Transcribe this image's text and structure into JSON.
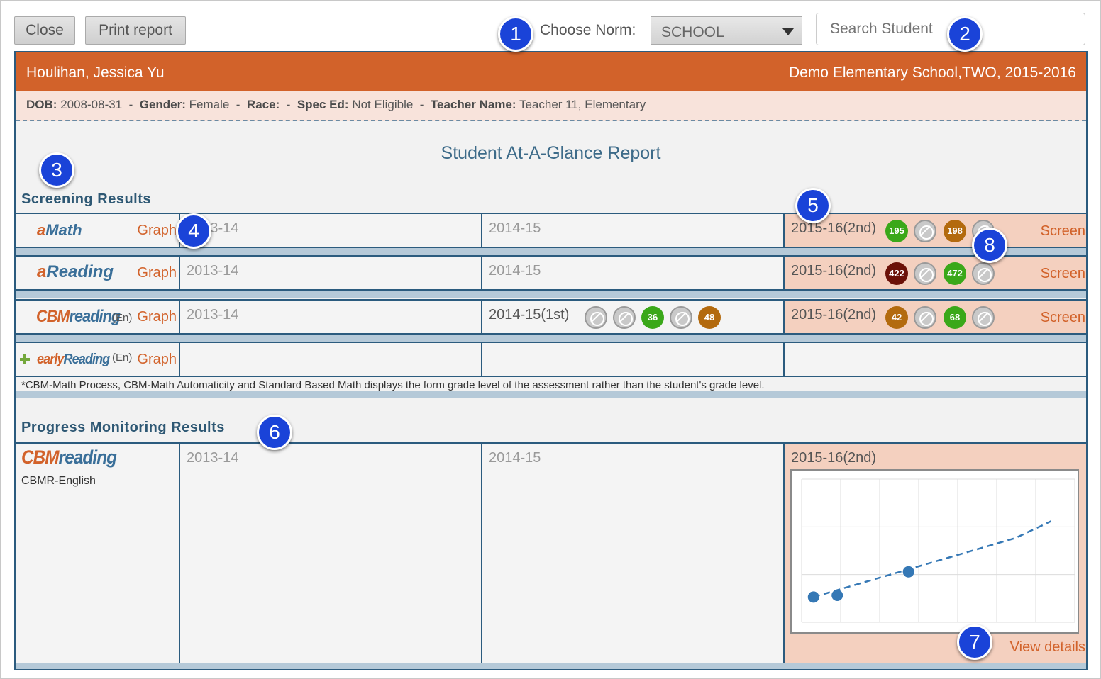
{
  "toolbar": {
    "close_label": "Close",
    "print_label": "Print report",
    "norm_label": "Choose Norm:",
    "norm_value": "SCHOOL",
    "search_placeholder": "Search Student"
  },
  "student": {
    "name": "Houlihan, Jessica Yu",
    "school": "Demo Elementary School,TWO, 2015-2016",
    "dob_label": "DOB:",
    "dob": "2008-08-31",
    "gender_label": "Gender:",
    "gender": "Female",
    "race_label": "Race:",
    "race": "",
    "spec_ed_label": "Spec Ed:",
    "spec_ed": "Not Eligible",
    "teacher_label": "Teacher Name:",
    "teacher": "Teacher 11, Elementary",
    "separator": "-"
  },
  "report_title": "Student At-A-Glance Report",
  "screening": {
    "title": "Screening Results",
    "graph_label": "Graph",
    "screen_label": "Screen",
    "rows": [
      {
        "logo_a": "a",
        "logo_rest": "Math",
        "lang": "",
        "y1": "2013-14",
        "y2": "2014-15",
        "y3": "2015-16(2nd)",
        "y2_badges": [],
        "y3_badges": [
          {
            "type": "green",
            "value": "195"
          },
          {
            "type": "na",
            "value": ""
          },
          {
            "type": "brown",
            "value": "198"
          },
          {
            "type": "na",
            "value": ""
          }
        ]
      },
      {
        "logo_a": "a",
        "logo_rest": "Reading",
        "lang": "",
        "y1": "2013-14",
        "y2": "2014-15",
        "y3": "2015-16(2nd)",
        "y2_badges": [],
        "y3_badges": [
          {
            "type": "dark",
            "value": "422"
          },
          {
            "type": "na",
            "value": ""
          },
          {
            "type": "green",
            "value": "472"
          },
          {
            "type": "na",
            "value": ""
          }
        ]
      },
      {
        "logo_a": "CBM",
        "logo_rest": "reading",
        "lang": "(En)",
        "y1": "2013-14",
        "y2": "2014-15(1st)",
        "y3": "2015-16(2nd)",
        "y2_badges": [
          {
            "type": "na",
            "value": ""
          },
          {
            "type": "na",
            "value": ""
          },
          {
            "type": "green",
            "value": "36"
          },
          {
            "type": "na",
            "value": ""
          },
          {
            "type": "brown",
            "value": "48"
          }
        ],
        "y3_badges": [
          {
            "type": "brown",
            "value": "42"
          },
          {
            "type": "na",
            "value": ""
          },
          {
            "type": "green",
            "value": "68"
          },
          {
            "type": "na",
            "value": ""
          }
        ]
      },
      {
        "logo_a": "early",
        "logo_rest": "Reading",
        "lang": "(En)"
      }
    ],
    "footnote": "*CBM-Math Process, CBM-Math Automaticity and Standard Based Math displays the form grade level of the assessment rather than the student's grade level."
  },
  "progress": {
    "title": "Progress Monitoring Results",
    "logo_a": "CBM",
    "logo_rest": "reading",
    "subtitle": "CBMR-English",
    "y1": "2013-14",
    "y2": "2014-15",
    "y3": "2015-16(2nd)",
    "view_details": "View details"
  },
  "chart_data": {
    "type": "scatter",
    "title": "",
    "xlabel": "",
    "ylabel": "",
    "grid": true,
    "points": [
      {
        "x": 1,
        "y": 1
      },
      {
        "x": 2,
        "y": 1.1
      },
      {
        "x": 5,
        "y": 2.5
      }
    ],
    "trend_line": [
      {
        "x": 1,
        "y": 1
      },
      {
        "x": 9.5,
        "y": 4.5
      },
      {
        "x": 11,
        "y": 5.5
      }
    ],
    "xlim": [
      0.5,
      12
    ],
    "ylim": [
      -0.5,
      8
    ],
    "colors": {
      "points": "#3578b5",
      "trend": "#3578b5"
    }
  },
  "markers": [
    "1",
    "2",
    "3",
    "4",
    "5",
    "6",
    "7",
    "8"
  ],
  "colors": {
    "accent": "#d2622a",
    "border": "#2b5b7e",
    "header_bg": "#d2622a"
  }
}
